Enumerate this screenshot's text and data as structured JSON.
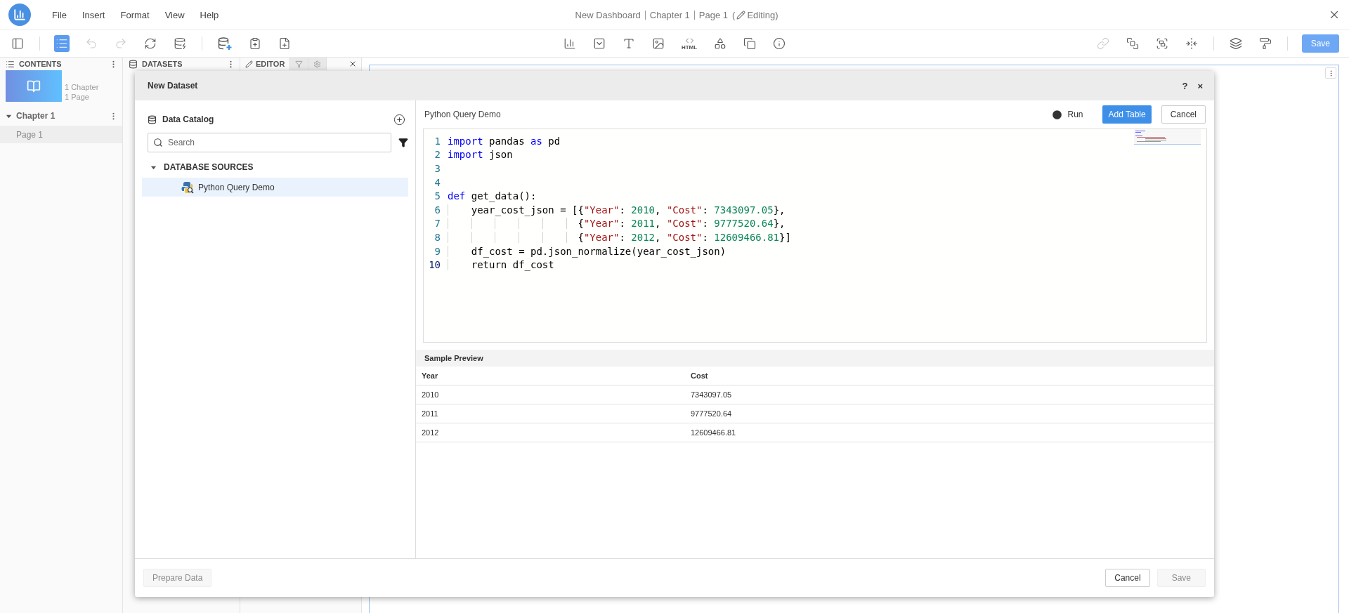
{
  "menu_bar": {
    "items": [
      "File",
      "Insert",
      "Format",
      "View",
      "Help"
    ],
    "title": [
      "New Dashboard",
      "Chapter 1",
      "Page 1"
    ],
    "mode_open": "(",
    "mode": "Editing)"
  },
  "toolbar": {
    "groups": [
      [
        {
          "selected": false,
          "disabled": false
        }
      ],
      [
        {
          "selected": true,
          "disabled": false
        },
        {
          "selected": false,
          "disabled": true
        },
        {
          "selected": false,
          "disabled": true
        },
        {
          "selected": false,
          "disabled": false
        },
        {
          "selected": false,
          "disabled": false
        }
      ],
      [
        {
          "selected": false,
          "disabled": false
        },
        {
          "selected": false,
          "disabled": false
        },
        {
          "selected": false,
          "disabled": false
        }
      ],
      [
        {
          "selected": false,
          "disabled": false
        },
        {
          "selected": false,
          "disabled": false
        },
        {
          "selected": false,
          "disabled": false
        },
        {
          "selected": false,
          "disabled": false
        },
        {
          "selected": false,
          "disabled": false,
          "label": "HTML"
        },
        {
          "selected": false,
          "disabled": false
        },
        {
          "selected": false,
          "disabled": false
        },
        {
          "selected": false,
          "disabled": false
        }
      ],
      [
        {
          "selected": false,
          "disabled": true
        },
        {
          "selected": false,
          "disabled": false
        },
        {
          "selected": false,
          "disabled": false
        },
        {
          "selected": false,
          "disabled": false
        }
      ],
      [
        {
          "selected": false,
          "disabled": false
        },
        {
          "selected": false,
          "disabled": false
        }
      ]
    ],
    "save": "Save"
  },
  "contents": {
    "title": "CONTENTS",
    "summary": [
      "1 Chapter",
      "1 Page"
    ],
    "chapters": [
      {
        "label": "Chapter 1",
        "expanded": true,
        "children": [
          {
            "label": "Page 1",
            "selected": true
          }
        ]
      }
    ]
  },
  "datasets": {
    "title": "DATASETS"
  },
  "editor_tabs": [
    {
      "kind": "text",
      "label": "EDITOR",
      "selected": true
    },
    {
      "kind": "filter",
      "selected": false
    },
    {
      "kind": "settings",
      "selected": false
    }
  ],
  "dialog": {
    "title": "New Dataset",
    "help": "?",
    "close": "×",
    "catalog": {
      "title": "Data Catalog",
      "search": {
        "placeholder": "Search"
      },
      "tree": [
        {
          "label": "DATABASE SOURCES",
          "expanded": true,
          "children": [
            {
              "label": "Python Query Demo",
              "selected": true
            }
          ]
        }
      ]
    },
    "query": {
      "title": "Python Query Demo",
      "run": "Run",
      "add": "Add Table",
      "cancel": "Cancel",
      "code": [
        {
          "number": "1",
          "current": false,
          "tokens": [
            {
              "kind": "keyword",
              "text": "import"
            },
            {
              "kind": "plain",
              "text": " pandas "
            },
            {
              "kind": "keyword",
              "text": "as"
            },
            {
              "kind": "plain",
              "text": " pd"
            }
          ]
        },
        {
          "number": "2",
          "current": false,
          "tokens": [
            {
              "kind": "keyword",
              "text": "import"
            },
            {
              "kind": "plain",
              "text": " json"
            }
          ]
        },
        {
          "number": "3",
          "current": false
        },
        {
          "number": "4",
          "current": false
        },
        {
          "number": "5",
          "current": false,
          "tokens": [
            {
              "kind": "keyword",
              "text": "def"
            },
            {
              "kind": "plain",
              "text": " get_data():"
            }
          ]
        },
        {
          "number": "6",
          "current": false,
          "tokens": [
            {
              "kind": "plain",
              "text": "    year_cost_json = [{"
            },
            {
              "kind": "string",
              "text": "\"Year\""
            },
            {
              "kind": "plain",
              "text": ": "
            },
            {
              "kind": "number",
              "text": "2010"
            },
            {
              "kind": "plain",
              "text": ", "
            },
            {
              "kind": "string",
              "text": "\"Cost\""
            },
            {
              "kind": "plain",
              "text": ": "
            },
            {
              "kind": "number",
              "text": "7343097.05"
            },
            {
              "kind": "plain",
              "text": "},"
            }
          ]
        },
        {
          "number": "7",
          "current": false,
          "tokens": [
            {
              "kind": "plain",
              "text": "                      {"
            },
            {
              "kind": "string",
              "text": "\"Year\""
            },
            {
              "kind": "plain",
              "text": ": "
            },
            {
              "kind": "number",
              "text": "2011"
            },
            {
              "kind": "plain",
              "text": ", "
            },
            {
              "kind": "string",
              "text": "\"Cost\""
            },
            {
              "kind": "plain",
              "text": ": "
            },
            {
              "kind": "number",
              "text": "9777520.64"
            },
            {
              "kind": "plain",
              "text": "},"
            }
          ]
        },
        {
          "number": "8",
          "current": false,
          "tokens": [
            {
              "kind": "plain",
              "text": "                      {"
            },
            {
              "kind": "string",
              "text": "\"Year\""
            },
            {
              "kind": "plain",
              "text": ": "
            },
            {
              "kind": "number",
              "text": "2012"
            },
            {
              "kind": "plain",
              "text": ", "
            },
            {
              "kind": "string",
              "text": "\"Cost\""
            },
            {
              "kind": "plain",
              "text": ": "
            },
            {
              "kind": "number",
              "text": "12609466.81"
            },
            {
              "kind": "plain",
              "text": "}]"
            }
          ]
        },
        {
          "number": "9",
          "current": false,
          "tokens": [
            {
              "kind": "plain",
              "text": "    df_cost = pd.json_normalize(year_cost_json)"
            }
          ]
        },
        {
          "number": "10",
          "current": true,
          "tokens": [
            {
              "kind": "plain",
              "text": "    return df_cost"
            }
          ]
        }
      ]
    },
    "preview": {
      "title": "Sample Preview",
      "columns": [
        "Year",
        "Cost"
      ],
      "rows": [
        [
          "2010",
          "7343097.05"
        ],
        [
          "2011",
          "9777520.64"
        ],
        [
          "2012",
          "12609466.81"
        ]
      ]
    },
    "footer": {
      "prepare": {
        "label": "Prepare Data",
        "disabled": true
      },
      "cancel": "Cancel",
      "save": {
        "label": "Save",
        "disabled": true
      }
    }
  }
}
